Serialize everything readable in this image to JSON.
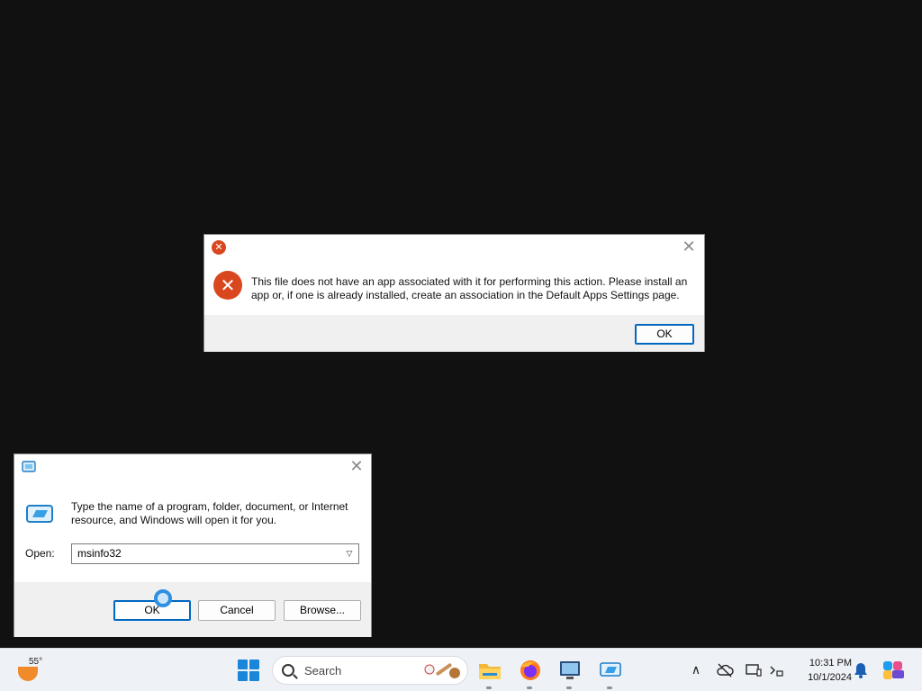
{
  "error_dialog": {
    "message": "This file does not have an app associated with it for performing this action. Please install an app or, if one is already installed, create an association in the Default Apps Settings page.",
    "ok_label": "OK",
    "close_glyph": "✕",
    "icon": "error-icon",
    "accent_color": "#d9471f"
  },
  "run_dialog": {
    "description": "Type the name of a program, folder, document, or Internet resource, and Windows will open it for you.",
    "open_label": "Open:",
    "open_value": "msinfo32",
    "ok_label": "OK",
    "cancel_label": "Cancel",
    "browse_label": "Browse...",
    "close_glyph": "✕",
    "icon": "run-icon"
  },
  "taskbar": {
    "weather_temp": "55°",
    "search_placeholder": "Search",
    "apps": [
      "file-explorer",
      "firefox",
      "remote-desktop",
      "run"
    ],
    "tray": {
      "chevron": "∧",
      "time": "10:31 PM",
      "date": "10/1/2024"
    },
    "accent_color": "#1a86d9"
  }
}
